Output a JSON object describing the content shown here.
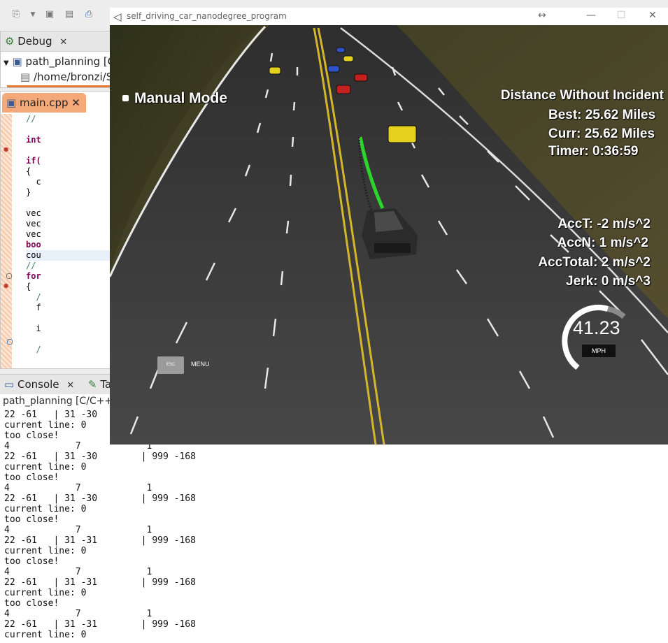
{
  "eclipse": {
    "debug_tab": "Debug",
    "tree": {
      "project": "path_planning [C/",
      "path": "/home/bronzi/S"
    },
    "editor_tab": "main.cpp",
    "code_lines": [
      "//",
      "",
      "int",
      "",
      "if(",
      "{",
      "  c",
      "}",
      "",
      "vec",
      "vec",
      "vec",
      "boo",
      "cou",
      "//",
      "for",
      "{",
      "  /",
      "  f",
      "",
      "  i",
      "",
      "  /"
    ],
    "console_tab": "Console",
    "tasks_tab": "Ta",
    "console_subtitle": "path_planning [C/C++ /",
    "console_lines": [
      "22 -61   | 31 -30",
      "current line: 0",
      "too close!",
      "4            7            1",
      "22 -61   | 31 -30        | 999 -168",
      "current line: 0",
      "too close!",
      "4            7            1",
      "22 -61   | 31 -30        | 999 -168",
      "current line: 0",
      "too close!",
      "4            7            1",
      "22 -61   | 31 -31        | 999 -168",
      "current line: 0",
      "too close!",
      "4            7            1",
      "22 -61   | 31 -31        | 999 -168",
      "current line: 0",
      "too close!",
      "4            7            1",
      "22 -61   | 31 -31        | 999 -168",
      "current line: 0"
    ]
  },
  "sim": {
    "title": "self_driving_car_nanodegree_program",
    "manual_mode": "Manual Mode",
    "distance_header": "Distance Without Incident",
    "best": "Best: 25.62 Miles",
    "curr": "Curr: 25.62 Miles",
    "timer": "Timer: 0:36:59",
    "acc_t": "AccT: -2 m/s^2",
    "acc_n": "AccN: 1 m/s^2",
    "acc_total": "AccTotal: 2 m/s^2",
    "jerk": "Jerk: 0 m/s^3",
    "speed": "41.23",
    "speed_unit": "MPH",
    "esc_label": "ESC",
    "menu_label": "MENU",
    "speed_fraction": 0.82,
    "colors": {
      "road": "#3f3f3f",
      "grass": "#3b3a22",
      "yellow_line": "#d4b62a",
      "path": "#2bd52b"
    }
  }
}
